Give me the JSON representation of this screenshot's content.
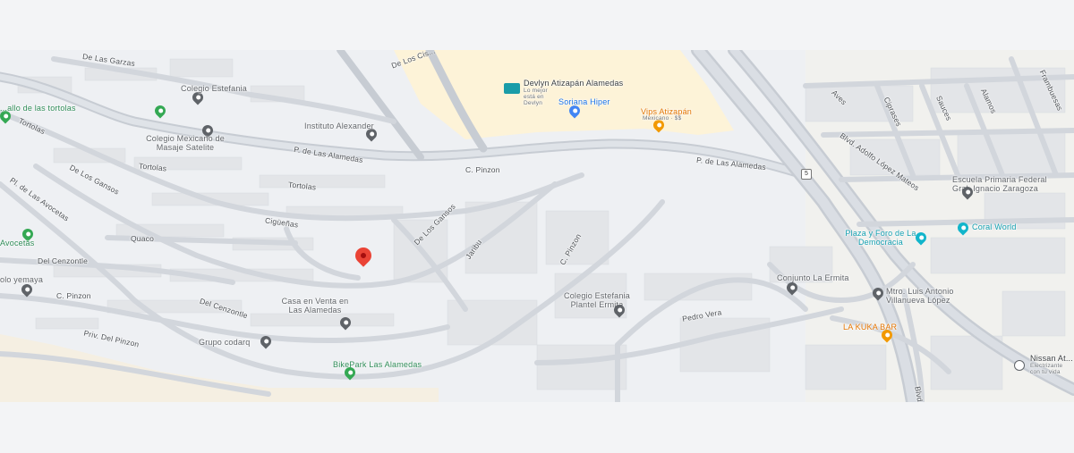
{
  "map": {
    "streets": [
      "De Las Garzas",
      "Tortolas",
      "P. de Las Alamedas",
      "C. Pinzon",
      "Tortolas",
      "Tortolas",
      "De Los Gansos",
      "Pl. de Las Avocetas",
      "Cigüeñas",
      "De Los Gansos",
      "Quaco",
      "Del Cenzontle",
      "C. Pinzon",
      "Del Cenzontle",
      "Priv. Del Pinzon",
      "Jaribu",
      "C. Pinzon",
      "Pedro Vera",
      "P. de Las Alamedas",
      "Blvd. Adolfo López Mateos",
      "Aves",
      "Ciprases",
      "Sauces",
      "Alamos",
      "Frambuesas",
      "Blvd",
      "De Los Cis..."
    ],
    "route_shield": "5",
    "places": [
      {
        "name": "Colegio Estefania",
        "color": "gray"
      },
      {
        "name": "...allo de las tortolas",
        "color": "green"
      },
      {
        "name": "Instituto Alexander",
        "color": "gray"
      },
      {
        "name": "Colegio Mexicano de Masaje Satelite",
        "color": "gray"
      },
      {
        "name": "Devlyn Atizapán Alamedas",
        "sub": "Lo mejor está en Devlyn",
        "color": "gray"
      },
      {
        "name": "Soriana Hiper",
        "color": "blue"
      },
      {
        "name": "Vips Atizapán",
        "sub": "Mexicano · $$",
        "color": "orange"
      },
      {
        "name": "Avocetas",
        "color": "green"
      },
      {
        "name": "olo yemaya",
        "color": "gray"
      },
      {
        "name": "Casa en Venta en Las Alamedas",
        "color": "gray"
      },
      {
        "name": "Grupo codarq",
        "color": "gray"
      },
      {
        "name": "BikePark Las Alamedas",
        "color": "green"
      },
      {
        "name": "Colegio Estefania Plantel Ermita",
        "color": "gray"
      },
      {
        "name": "Conjunto La Ermita",
        "color": "gray"
      },
      {
        "name": "Plaza y Foro de La Democracia",
        "color": "teal"
      },
      {
        "name": "Coral World",
        "color": "teal"
      },
      {
        "name": "Escuela Primaria Federal Gral. Ignacio Zaragoza",
        "color": "gray"
      },
      {
        "name": "Mtro. Luis Antonio Villanueva López",
        "color": "gray"
      },
      {
        "name": "LA KUKA BAR",
        "color": "orange"
      },
      {
        "name": "Nissan At...",
        "sub": "Electrizante con tu vida",
        "color": "gray"
      }
    ]
  }
}
